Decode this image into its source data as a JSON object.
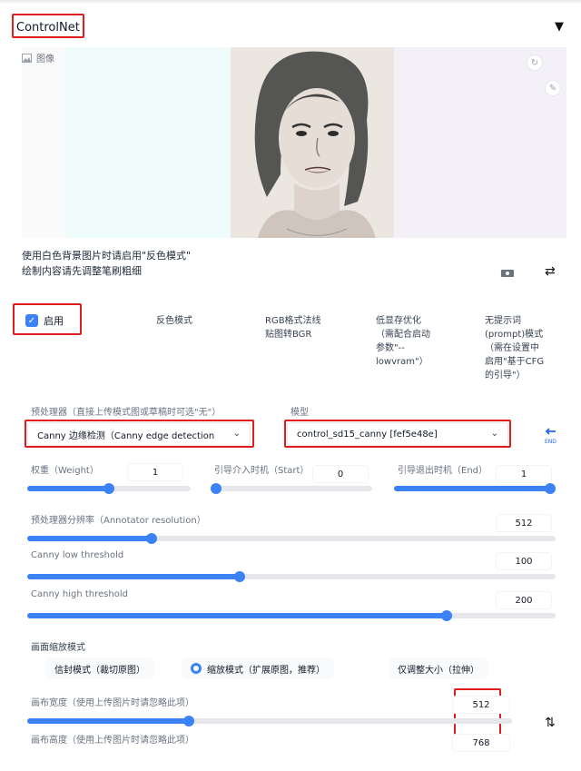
{
  "header": {
    "title": "ControlNet",
    "collapse_icon": "triangle-down-icon"
  },
  "image_input": {
    "label": "图像",
    "label_icon": "image-icon",
    "buttons": [
      "refresh-icon",
      "edit-icon"
    ]
  },
  "note": {
    "line1": "使用白色背景图片时请启用\"反色模式\"",
    "line2": "绘制内容请先调整笔刷粗细"
  },
  "options": {
    "enable": {
      "label": "启用",
      "checked": true
    },
    "invert": "反色模式",
    "rgb_bgr": [
      "RGB格式法线",
      "贴图转BGR"
    ],
    "lowvram": [
      "低显存优化",
      "（需配合启动",
      "参数\"--",
      "lowvram\"）"
    ],
    "guess_mode": [
      "无提示词",
      "(prompt)模式",
      "（需在设置中",
      "启用\"基于CFG",
      "的引导\"）"
    ]
  },
  "preprocessor": {
    "label": "预处理器（直接上传模式图或草稿时可选\"无\"）",
    "value": "Canny 边缘检测（Canny edge detection"
  },
  "model": {
    "label": "模型",
    "value": "control_sd15_canny [fef5e48e]"
  },
  "sliders": {
    "weight": {
      "label": "权重（Weight）",
      "value": "1",
      "fraction": 0.5
    },
    "guidance_start": {
      "label": "引导介入时机（Start）",
      "value": "0",
      "fraction": 0.0
    },
    "guidance_end": {
      "label": "引导退出时机（End）",
      "value": "1",
      "fraction": 1.0
    },
    "annotator_resolution": {
      "label": "预处理器分辨率（Annotator resolution）",
      "value": "512",
      "fraction": 0.23
    },
    "canny_low": {
      "label": "Canny low threshold",
      "value": "100",
      "fraction": 0.4
    },
    "canny_high": {
      "label": "Canny high threshold",
      "value": "200",
      "fraction": 0.8
    }
  },
  "resize_mode": {
    "title": "画面缩放模式",
    "options": [
      "信封模式（裁切原图）",
      "缩放模式（扩展原图，推荐）",
      "仅调整大小（拉伸）"
    ],
    "selected": 1
  },
  "canvas": {
    "width": {
      "label": "画布宽度（使用上传图片时请忽略此项）",
      "value": "512",
      "fraction": 0.33
    },
    "height": {
      "label": "画布高度（使用上传图片时请忽略此项）",
      "value": "768"
    }
  },
  "colors": {
    "accent": "#3b82f6",
    "highlight": "#e11d1d"
  }
}
